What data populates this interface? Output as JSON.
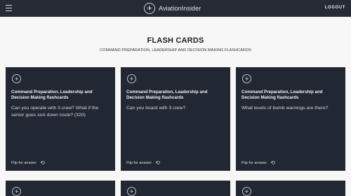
{
  "header": {
    "brand_name": "AviationInsider",
    "brand_icon": "plane-icon",
    "menu_icon": "hamburger-menu-icon",
    "logout_label": "LOGOUT",
    "background": "#252a35"
  },
  "page": {
    "title": "FLASH CARDS",
    "subtitle": "COMMAND PREPARATION, LEADERSHIP AND DECISION MAKING FLASHCARDS"
  },
  "cards": [
    {
      "title": "Command Preparation, Leadership and Decision Making flashcards",
      "question": "Can you operate with 3 crew? What if the senior goes sick down route? (320)",
      "flip_label": "Flip for answer",
      "flip_icon": "refresh-icon"
    },
    {
      "title": "Command Preparation, Leadership and Decision Making flashcards",
      "question": "Can you board with 3 crew?",
      "flip_label": "Flip for answer",
      "flip_icon": "refresh-icon"
    },
    {
      "title": "Command Preparation, Leadership and Decision Making flashcards",
      "question": "What levels of bomb warnings are there?",
      "flip_label": "Flip for answer",
      "flip_icon": "refresh-icon"
    }
  ],
  "colors": {
    "card_background": "#222734",
    "page_background": "#f7f7f7"
  }
}
